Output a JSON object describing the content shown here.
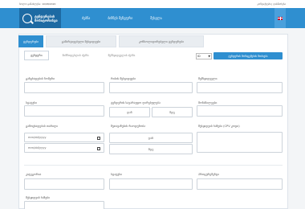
{
  "topbar": {
    "left": "ბოლო განახლება: 10/08/2020",
    "right": "კონტაქტები | დახმარება"
  },
  "nav": {
    "logo_line1": "ტენდერების",
    "logo_line2": "მონიტორინგი",
    "links": [
      "ძებნა",
      "ბიზნეს მენეჯერი",
      "შესვლა"
    ]
  },
  "main_tabs": [
    "ტენდერები",
    "გამარტივებული შესყიდვები",
    "კონსოლიდირებული ტენდერები"
  ],
  "sub_tabs": [
    "ტენდერი",
    "მიმწოდებლის ძებნა",
    "შემსყიდველის ძებნა"
  ],
  "id_select": {
    "value": "ID",
    "arrow": "▼"
  },
  "search_button": "ტენდერის მონაცემების მოძიება",
  "form": {
    "tender_number_label": "განცხადების ნომერი",
    "tender_type_label": "რისის შესყიდვები",
    "supplier_label": "შემსყიდველი",
    "status_label": "სტატუსი",
    "amount_label": "ტენდერის სავარაუდო ღირებულება",
    "bidders_label": "მონაწილეები",
    "amount_from": "დან",
    "amount_to": "მდე",
    "announce_date_label": "გამოცხადების თარიღი",
    "bid_count_label": "შეთავაზების რაოდენობა",
    "cpv_label": "შესყიდვის ხაზები (CPV კოდი)",
    "date_from_placeholder": "mm/dd/yyyy",
    "date_to_placeholder": "mm/dd/yyyy",
    "count_from": "დან",
    "count_to": "მდე",
    "category_label": "კატეგორია",
    "region_label": "სტატუსი",
    "organizer_label": "პროცურემენტი",
    "search_word_label": "შესყიდვის ხაზები"
  },
  "colors": {
    "accent": "#2f8fd0",
    "logo_bg": "#1d6aa3"
  }
}
